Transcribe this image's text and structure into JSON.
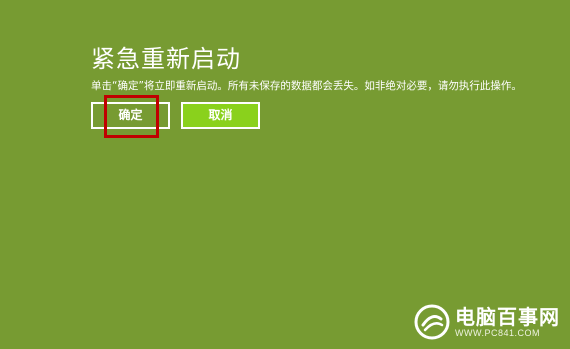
{
  "dialog": {
    "title": "紧急重新启动",
    "message": "单击“确定”将立即重新启动。所有未保存的数据都会丢失。如非绝对必要，请勿执行此操作。",
    "ok_label": "确定",
    "cancel_label": "取消"
  },
  "watermark": {
    "name": "电脑百事网",
    "url": "WWW.PC841.COM"
  },
  "colors": {
    "background": "#779b32",
    "cancel_button": "#8ad11c",
    "highlight_box": "#c00000"
  }
}
